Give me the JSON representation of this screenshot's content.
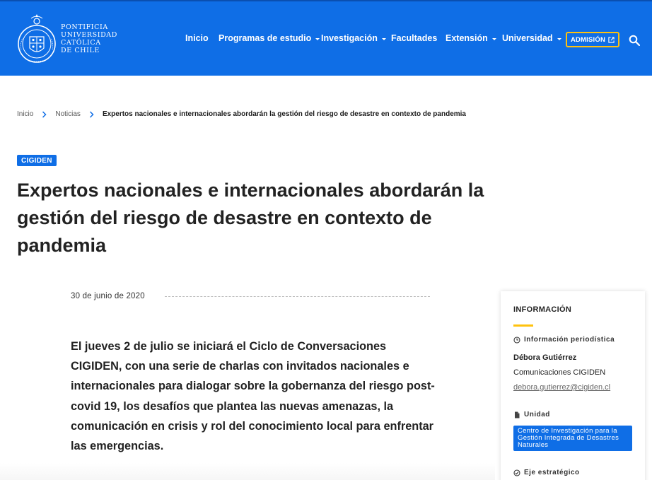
{
  "header": {
    "logo_lines": [
      "PONTIFICIA",
      "UNIVERSIDAD",
      "CATÓLICA",
      "DE CHILE"
    ],
    "nav": [
      {
        "label": "Inicio",
        "dropdown": false
      },
      {
        "label": "Programas de estudio",
        "dropdown": true
      },
      {
        "label": "Investigación",
        "dropdown": true
      },
      {
        "label": "Facultades",
        "dropdown": false
      },
      {
        "label": "Extensión",
        "dropdown": true
      },
      {
        "label": "Universidad",
        "dropdown": true
      }
    ],
    "admision_label": "ADMISIÓN",
    "colors": {
      "bar": "#0f6ee6",
      "accent": "#ffc20e"
    }
  },
  "breadcrumb": {
    "home": "Inicio",
    "section": "Noticias",
    "current": "Expertos nacionales e internacionales abordarán la gestión del riesgo de desastre en contexto de pandemia"
  },
  "article": {
    "tag": "CIGIDEN",
    "title": "Expertos nacionales e internacionales abordarán la gestión del riesgo de desastre en contexto de pandemia",
    "date": "30 de junio de 2020",
    "lead": "El jueves 2 de julio se iniciará el Ciclo de Conversaciones CIGIDEN, con una serie de charlas con invitados nacionales e internacionales para dialogar sobre la gobernanza del riesgo post-covid 19, los desafíos que plantea las nuevas amenazas, la comunicación en crisis y rol del conocimiento local para enfrentar las emergencias."
  },
  "sidebar": {
    "heading": "INFORMACIÓN",
    "press_label": "Información periodística",
    "contact_name": "Débora Gutiérrez",
    "contact_org": "Comunicaciones CIGIDEN",
    "contact_email": "debora.gutierrez@cigiden.cl",
    "unit_label": "Unidad",
    "unit_name": "Centro de Investigación para la Gestión Integrada de Desastres Naturales",
    "axis_label": "Eje estratégico"
  }
}
